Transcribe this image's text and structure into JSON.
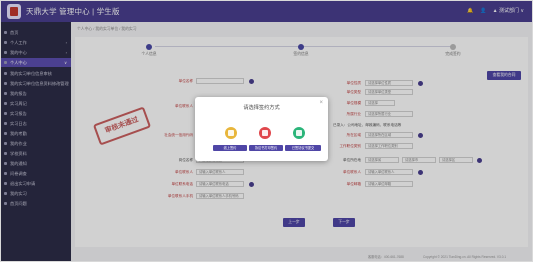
{
  "topbar": {
    "brand": "天鼎大学 管理中心 | 学生版",
    "bell": "🔔",
    "user": "👤",
    "dept": "▲ 测试部门 ∨"
  },
  "sidebar": {
    "items": [
      {
        "label": "首页"
      },
      {
        "label": "个人工作",
        "chev": "›"
      },
      {
        "label": "我的中心",
        "chev": "›"
      },
      {
        "label": "个人中心",
        "chev": "∨"
      },
      {
        "label": "我的实习单位信息审核"
      },
      {
        "label": "我的实习单位信息资料修改管理"
      },
      {
        "label": "我的报告"
      },
      {
        "label": "实习周记"
      },
      {
        "label": "实习报告"
      },
      {
        "label": "实习日志"
      },
      {
        "label": "我的考勤"
      },
      {
        "label": "我的作业"
      },
      {
        "label": "学校资料"
      },
      {
        "label": "我的通知"
      },
      {
        "label": "问卷调查"
      },
      {
        "label": "退出实习申请"
      },
      {
        "label": "我的实习"
      },
      {
        "label": "首页问题"
      }
    ]
  },
  "main": {
    "breadcrumb": "个人中心 / 我的实习单位 / 我的实习",
    "steps": [
      "个人信息",
      "签约信息",
      "完成签约"
    ],
    "stamp": "审核未通过",
    "left_fields": [
      {
        "label": "单位名称",
        "value": ""
      },
      {
        "label": "单位联系人",
        "value": "请输入单位联系人"
      },
      {
        "label": "社会统一信用代码",
        "value": "请输入社会统一信用代码"
      },
      {
        "label": "岗位名称",
        "value": "广西壮族自治区"
      },
      {
        "label": "单位联系人",
        "value": "请输入单位联系人"
      },
      {
        "label": "单位联系电话",
        "value": "请输入单位联系电话"
      },
      {
        "label": "单位联系人手机",
        "value": "请输入单位联系人手机号码"
      }
    ],
    "right_fields": [
      {
        "label": "单位性质",
        "value": "请选择单位性质"
      },
      {
        "label": "单位类型",
        "value": "请选择单位类型"
      },
      {
        "label": "单位规模",
        "value": "请选择"
      },
      {
        "label": "所属行业",
        "value": "请选择所属行业"
      },
      {
        "label": "所在区域",
        "value": "请选择所在区域"
      },
      {
        "label": "工作职位类别",
        "value": "请选择工作职位类别"
      },
      {
        "label": "单位所在地",
        "value": "请选择"
      },
      {
        "label": "单位联系人",
        "value": "请输入单位联系人"
      },
      {
        "label": "单位邮箱",
        "value": "请输入单位邮箱"
      }
    ],
    "region_hint": "已录入：公司地址、邮政编码、联系电话等",
    "region_selects": [
      "请选择省",
      "请选择市",
      "请选择区"
    ],
    "top_button": "查看我的合同",
    "prev": "上一步",
    "next": "下一步",
    "footer_left": "客服电话：400-661-7688",
    "footer_right": "Copyright © 2021 TianDing.cn. All Rights Reserved.   V3.0.1"
  },
  "modal": {
    "title": "请选择签约方式",
    "close": "×",
    "options": [
      {
        "label": "线上签约",
        "color": "#e8b63c"
      },
      {
        "label": "协议书打印签约",
        "color": "#e0474c"
      },
      {
        "label": "已签协议书提交",
        "color": "#2bb57a"
      }
    ]
  }
}
